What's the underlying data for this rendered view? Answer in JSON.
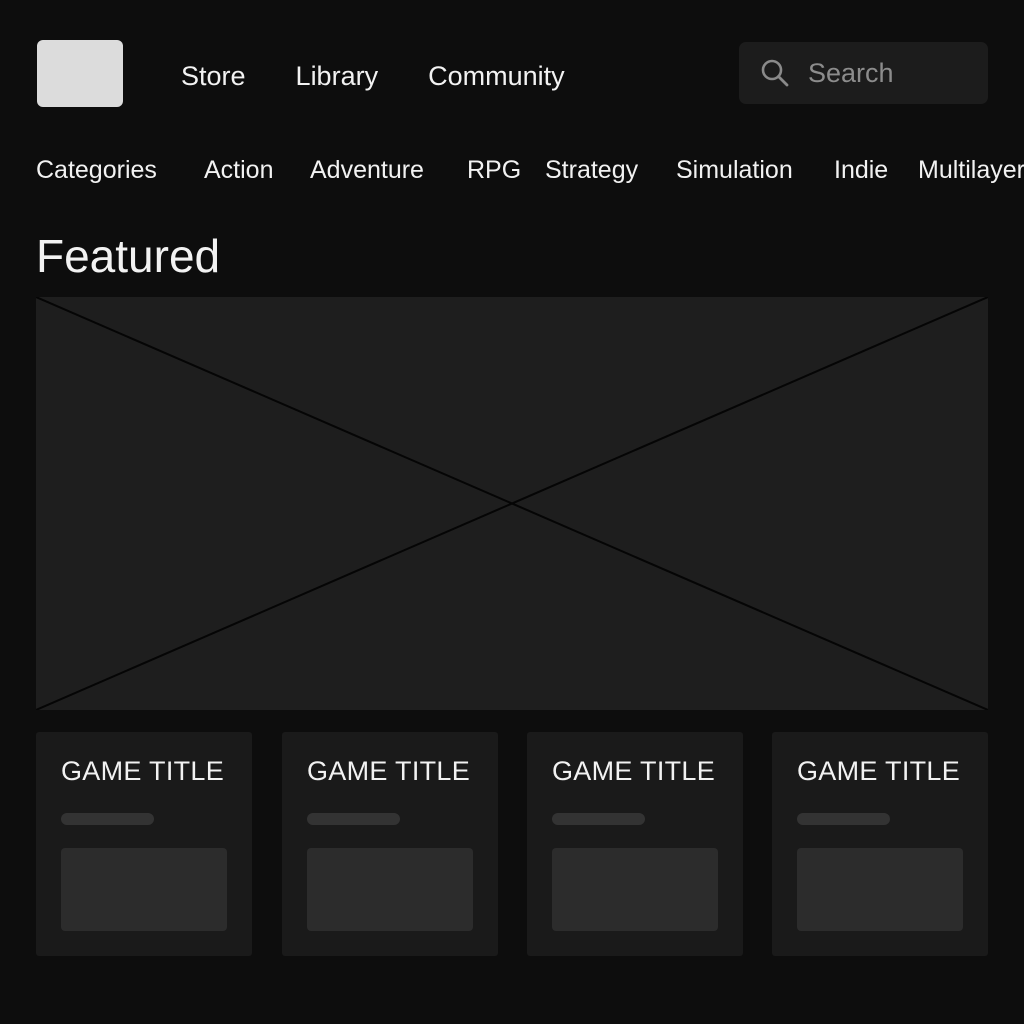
{
  "colors": {
    "background": "#0d0d0d",
    "surface": "#1e1e1e",
    "text": "#f2f2f2",
    "muted": "#8c8c8c"
  },
  "header": {
    "logo": "logo-placeholder",
    "nav": [
      {
        "label": "Store"
      },
      {
        "label": "Library"
      },
      {
        "label": "Community"
      }
    ],
    "search": {
      "icon": "search-icon",
      "placeholder": "Search",
      "value": ""
    }
  },
  "categories": [
    {
      "label": "Categories"
    },
    {
      "label": "Action"
    },
    {
      "label": "Adventure"
    },
    {
      "label": "RPG"
    },
    {
      "label": "Strategy"
    },
    {
      "label": "Simulation"
    },
    {
      "label": "Indie"
    },
    {
      "label": "Multilayer"
    }
  ],
  "featured": {
    "title": "Featured",
    "hero": "image-placeholder"
  },
  "games": [
    {
      "title": "GAME TITLE"
    },
    {
      "title": "GAME TITLE"
    },
    {
      "title": "GAME TITLE"
    },
    {
      "title": "GAME TITLE"
    }
  ]
}
